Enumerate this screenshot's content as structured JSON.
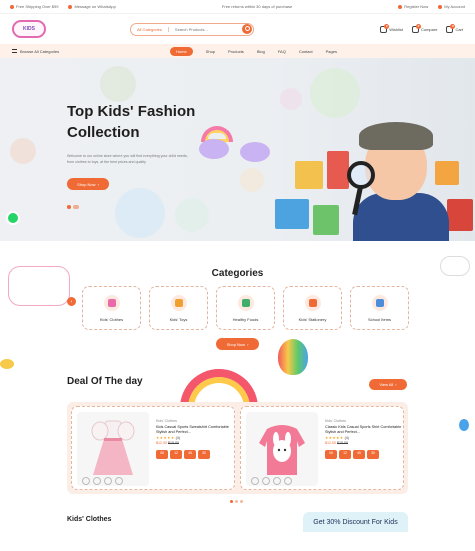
{
  "topbar": {
    "left": [
      "Free Shipping Over $99",
      "Message on WhatsApp"
    ],
    "center": "Free returns within 30 days of purchase",
    "right": [
      "Register Now",
      "My Account"
    ]
  },
  "header": {
    "logo_text": "KIDS",
    "search": {
      "category": "All Categories",
      "placeholder": "Search Products..."
    },
    "icons": [
      {
        "label": "Wishlist",
        "badge": "0"
      },
      {
        "label": "Compare",
        "badge": "0"
      },
      {
        "label": "Cart",
        "badge": "0"
      }
    ]
  },
  "nav": {
    "browse_label": "Browse All Categories",
    "items": [
      "Home",
      "Shop",
      "Products",
      "Blog",
      "FAQ",
      "Contact",
      "Pages"
    ],
    "active": "Home"
  },
  "hero": {
    "title_line1": "Top Kids' Fashion",
    "title_line2": "Collection",
    "description": "Welcome to our online store where you will find everything your child needs, from clothes to toys, at the best prices and quality",
    "button": "Shop Now"
  },
  "categories": {
    "title": "Categories",
    "items": [
      {
        "label": "Kids' Clothes",
        "icon": "dress-icon",
        "color": "#e86aa6"
      },
      {
        "label": "Kids' Toys",
        "icon": "toy-icon",
        "color": "#f0a030"
      },
      {
        "label": "Healthy Foods",
        "icon": "food-icon",
        "color": "#3fae6a"
      },
      {
        "label": "Kids' Stationery",
        "icon": "stationery-icon",
        "color": "#f06a35"
      },
      {
        "label": "School Items",
        "icon": "school-bag-icon",
        "color": "#4c8ed9"
      }
    ],
    "button": "Shop Now"
  },
  "deal": {
    "title": "Deal Of The day",
    "view_all": "View All",
    "products": [
      {
        "category": "Kids' Clothes",
        "name": "Kids Casual Sports Sweatshirt Comfortable Stylish and Perfect...",
        "rating": "★★★★★",
        "reviews": "(4)",
        "price": "$12.00",
        "old_price": "$15.00",
        "timer": [
          "05",
          "12",
          "45",
          "30"
        ]
      },
      {
        "category": "Kids' Clothes",
        "name": "Classic Kids Casual Sports Shirt Comfortable Stylish and Perfect...",
        "rating": "★★★★★",
        "reviews": "(4)",
        "price": "$12.00",
        "old_price": "$15.00",
        "timer": [
          "05",
          "12",
          "45",
          "30"
        ]
      }
    ]
  },
  "bottom": {
    "section_title": "Kids' Clothes",
    "promo": "Get 30% Discount For Kids"
  },
  "colors": {
    "accent": "#f06a35",
    "nav_bg": "#fdf1ea",
    "deal_bg": "#fbeee7"
  }
}
